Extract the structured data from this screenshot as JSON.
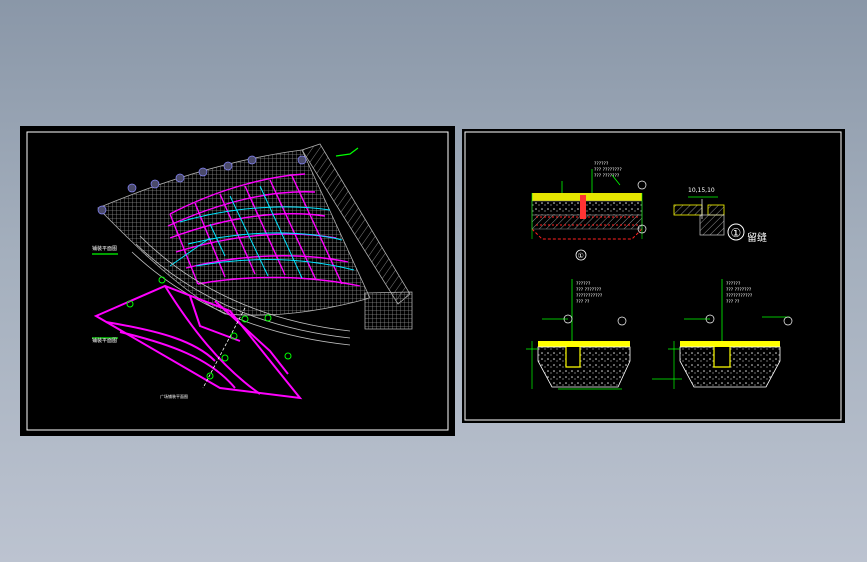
{
  "colors": {
    "background_top": "#8a97a8",
    "background_bottom": "#bcc3d0",
    "sheet": "#000000",
    "frame": "#ffffff",
    "hatch": "#9a9a9a",
    "magenta": "#ff00ff",
    "cyan": "#00e5ff",
    "green": "#00ff00",
    "yellow": "#ffff00",
    "red": "#ff2020",
    "white": "#ffffff"
  },
  "left_sheet": {
    "label_plan_a": "铺装平面图",
    "label_plan_b": "铺装平面图",
    "caption": "广场铺装平面图"
  },
  "right_sheet": {
    "callout_marker": "①",
    "callout_text": "留缝",
    "joint_dims": "10,15,10",
    "detail_marker": "①",
    "notes_top": [
      "??????",
      "??? ????????",
      "??? ???????"
    ],
    "notes_bl": [
      "??????",
      "??? ???????",
      "???????????",
      "??? ??"
    ],
    "notes_br": [
      "??????",
      "??? ???????",
      "???????????",
      "??? ??"
    ]
  }
}
